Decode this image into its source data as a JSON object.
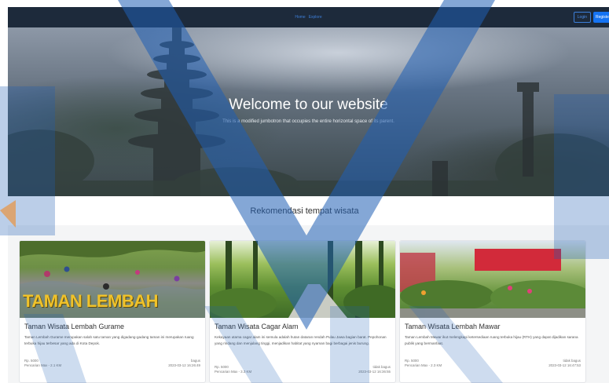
{
  "navbar": {
    "links": [
      "Home",
      "Explore"
    ],
    "login_label": "Login",
    "register_label": "Register"
  },
  "hero": {
    "title": "Welcome to our website",
    "subtitle": "This is a modified jumbotron that occupies the entire horizontal space of its parent."
  },
  "section": {
    "title": "Rekomendasi tempat wisata"
  },
  "cards": [
    {
      "image_caption": "TAMAN LEMBAH",
      "title": "Taman Wisata Lembah Gurame",
      "description": "Taman Lembah Gurame merupakan salah satu taman yang digadang-gadang taman ini merupakan ruang terbuka hijau terbesar yang ada di Kota Depok.",
      "price": "Rp. 5000",
      "rating": "bagus",
      "distance": "Pencarian Max - 2.1 KM",
      "timestamp": "2023-03-12 16:26:49"
    },
    {
      "title": "Taman Wisata Cagar Alam",
      "description": "Kekayaan utama cagar alam ini semula adalah hutan dataran rendah Pulau Jawa bagian barat. Pepohonan yang rindang dan menjulang tinggi, menjadikan habitat yang nyaman bagi berbagai jenis burung.",
      "price": "Rp. 5000",
      "rating": "tidak bagus",
      "distance": "Pencarian Max - 3.3 KM",
      "timestamp": "2023-03-12 16:36:55"
    },
    {
      "title": "Taman Wisata Lembah Mawar",
      "description": "Taman Lembah Mawar ikut melengkapi ketersediaan ruang terbuka hijau (RTH) yang dapat dijadikan sarana publik yang bermanfaat.",
      "price": "Rp. 5000",
      "rating": "tidak bagus",
      "distance": "Pencarian Max - 2.3 KM",
      "timestamp": "2023-03-12 16:47:53"
    }
  ],
  "colors": {
    "navbar_bg": "#1d2a3b",
    "link": "#3d7fd9",
    "primary_button": "#1573f2",
    "watermark": "#1f5fb4",
    "watermark_accent": "#f08a24"
  }
}
